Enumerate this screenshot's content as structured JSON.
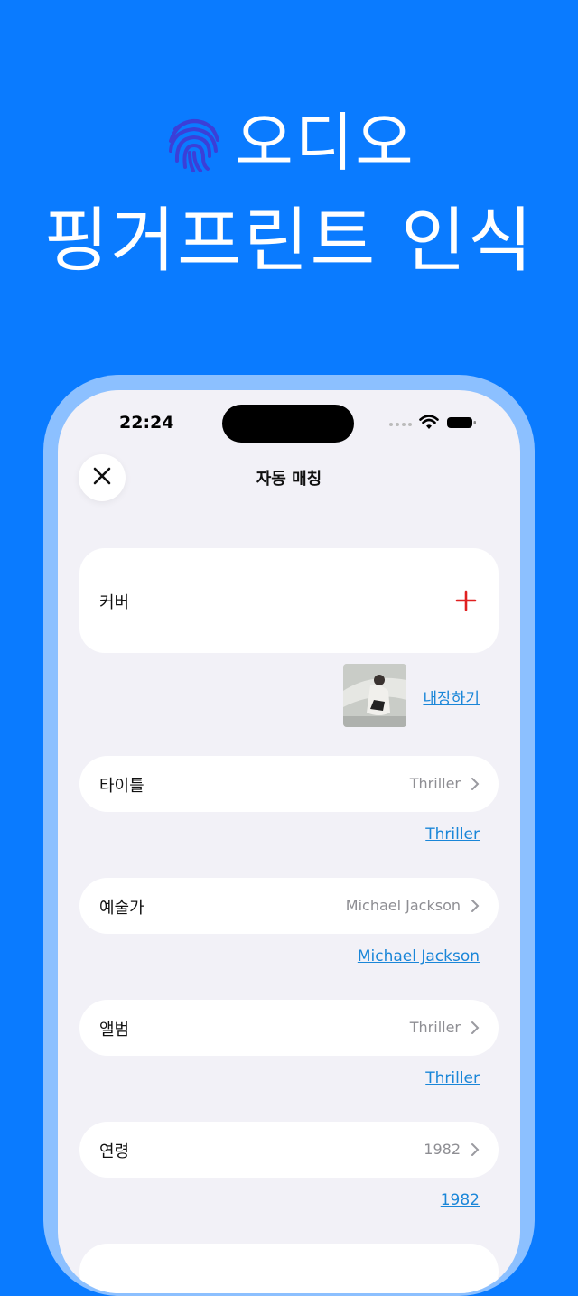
{
  "promo": {
    "line1": "오디오",
    "line2": "핑거프린트 인식"
  },
  "status_bar": {
    "time": "22:24"
  },
  "nav": {
    "title": "자동 매칭"
  },
  "cover": {
    "label": "커버",
    "save_link": "내장하기"
  },
  "fields": [
    {
      "label": "타이틀",
      "value": "Thriller",
      "suggestion": "Thriller"
    },
    {
      "label": "예술가",
      "value": "Michael Jackson",
      "suggestion": "Michael Jackson"
    },
    {
      "label": "앨범",
      "value": "Thriller",
      "suggestion": "Thriller"
    },
    {
      "label": "연령",
      "value": "1982",
      "suggestion": "1982"
    }
  ],
  "colors": {
    "background": "#0a7bff",
    "frame": "#8cc0ff",
    "screen": "#f2f1f7",
    "accent_link": "#1a86d8",
    "plus_red": "#e02020",
    "fingerprint": "#3b3fd8"
  }
}
